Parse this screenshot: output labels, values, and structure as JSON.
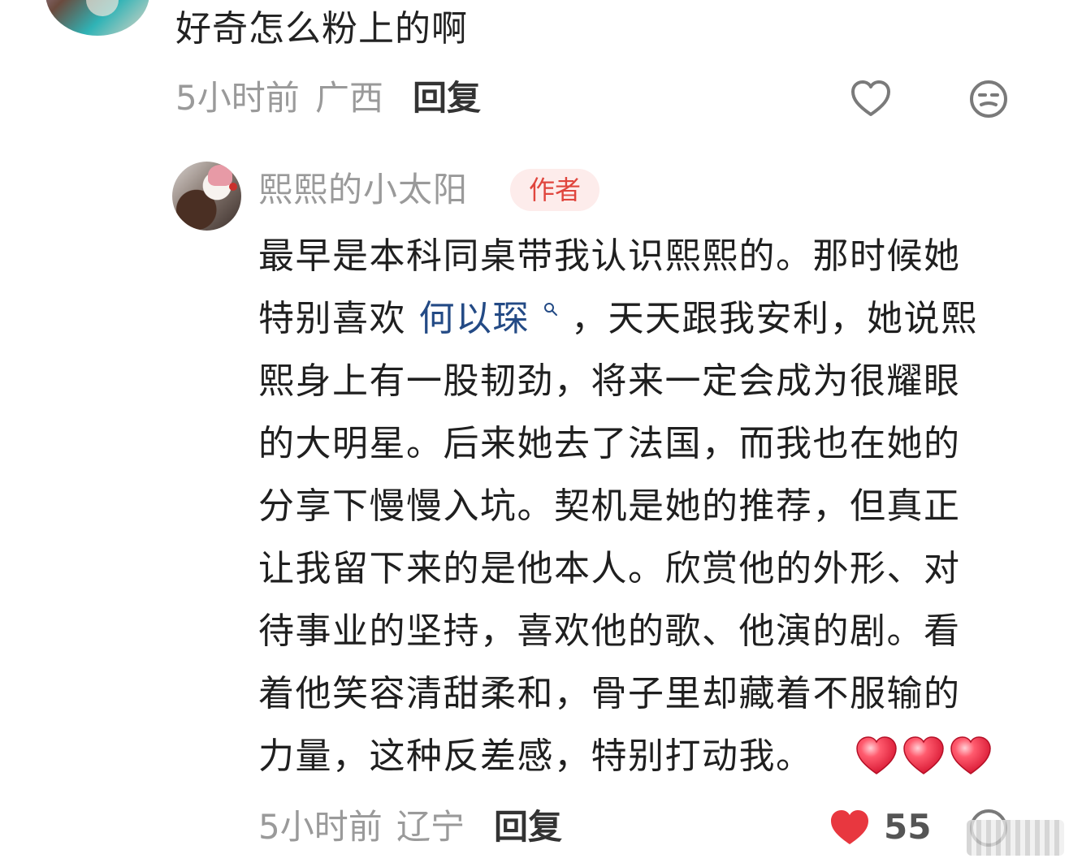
{
  "first_comment": {
    "text": "好奇怎么粉上的啊",
    "time": "5小时前",
    "location": "广西",
    "reply_label": "回复",
    "icons": {
      "like": "heart-outline-icon",
      "dislike": "unhappy-face-icon"
    }
  },
  "second_comment": {
    "username": "熙熙的小太阳",
    "badge": "作者",
    "lines": [
      "最早是本科同桌带我认识熙熙的。那时候她",
      "特别喜欢",
      "何以琛",
      "，天天跟我安利，她说熙",
      "熙身上有一股韧劲，将来一定会成为很耀眼",
      "的大明星。后来她去了法国，而我也在她的",
      "分享下慢慢入坑。契机是她的推荐，但真正",
      "让我留下来的是他本人。欣赏他的外形、对",
      "待事业的坚持，喜欢他的歌、他演的剧。看",
      "着他笑容清甜柔和，骨子里却藏着不服输的",
      "力量，这种反差感，特别打动我。"
    ],
    "emoji": [
      "red-heart-icon",
      "red-heart-icon",
      "red-heart-icon"
    ],
    "time": "5小时前",
    "location": "辽宁",
    "reply_label": "回复",
    "like_count_visible": "55",
    "icons": {
      "like": "heart-filled-icon",
      "dislike": "face-icon"
    },
    "colors": {
      "mention": "#234a85",
      "like_red": "#e8373f",
      "badge_bg": "#fdeceb",
      "badge_text": "#e0453d"
    }
  }
}
